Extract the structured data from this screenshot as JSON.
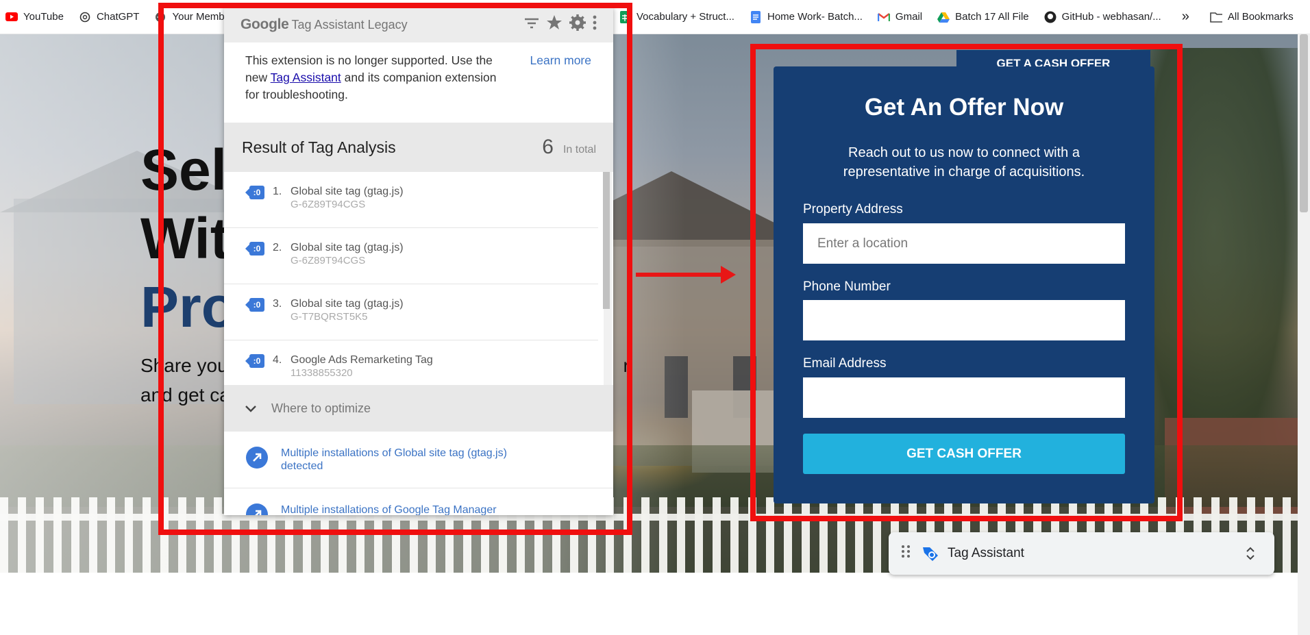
{
  "bookmarks": {
    "items": [
      {
        "label": "YouTube",
        "icon": "youtube-icon"
      },
      {
        "label": "ChatGPT",
        "icon": "chatgpt-icon"
      },
      {
        "label": "Your Membe",
        "icon": "globe-icon"
      },
      {
        "label": "Vocabulary + Struct...",
        "icon": "sheets-icon"
      },
      {
        "label": "Home Work- Batch...",
        "icon": "docs-icon"
      },
      {
        "label": "Gmail",
        "icon": "gmail-icon"
      },
      {
        "label": "Batch 17 All File",
        "icon": "drive-icon"
      },
      {
        "label": "GitHub - webhasan/...",
        "icon": "github-icon"
      }
    ],
    "more": "»",
    "all_bookmarks": "All Bookmarks"
  },
  "hero": {
    "line1": "Sell",
    "line2": "Wit",
    "line3": "Pro",
    "sub_line1_start": "Share you",
    "sub_line1_end": "r,",
    "sub_line2": "and get ca"
  },
  "extension": {
    "brand": "Google",
    "title": "Tag Assistant Legacy",
    "notice": {
      "text_before": "This extension is no longer supported. Use the new ",
      "link": "Tag Assistant",
      "text_after": " and its companion extension for troubleshooting.",
      "learn_more": "Learn more"
    },
    "result": {
      "title": "Result of Tag Analysis",
      "count": "6",
      "total_label": "In total"
    },
    "tags": [
      {
        "num": "1.",
        "name": "Global site tag (gtag.js)",
        "id": "G-6Z89T94CGS"
      },
      {
        "num": "2.",
        "name": "Global site tag (gtag.js)",
        "id": "G-6Z89T94CGS"
      },
      {
        "num": "3.",
        "name": "Global site tag (gtag.js)",
        "id": "G-T7BQRST5K5"
      },
      {
        "num": "4.",
        "name": "Google Ads Remarketing Tag",
        "id": "11338855320"
      }
    ],
    "optimize": {
      "title": "Where to optimize",
      "items": [
        {
          "text": "Multiple installations of Global site tag (gtag.js) detected"
        },
        {
          "text": "Multiple installations of Google Tag Manager"
        }
      ]
    }
  },
  "offer": {
    "tab": "GET A CASH OFFER",
    "title": "Get An Offer Now",
    "subtitle": "Reach out to us now to connect with a representative in charge of acquisitions.",
    "fields": {
      "address_label": "Property Address",
      "address_placeholder": "Enter a location",
      "phone_label": "Phone Number",
      "email_label": "Email Address"
    },
    "submit": "GET CASH OFFER",
    "colors": {
      "panel": "#163e73",
      "button": "#22b1dd"
    }
  },
  "tag_assistant_bar": {
    "label": "Tag Assistant"
  },
  "annotation_color": "#f00f0f"
}
